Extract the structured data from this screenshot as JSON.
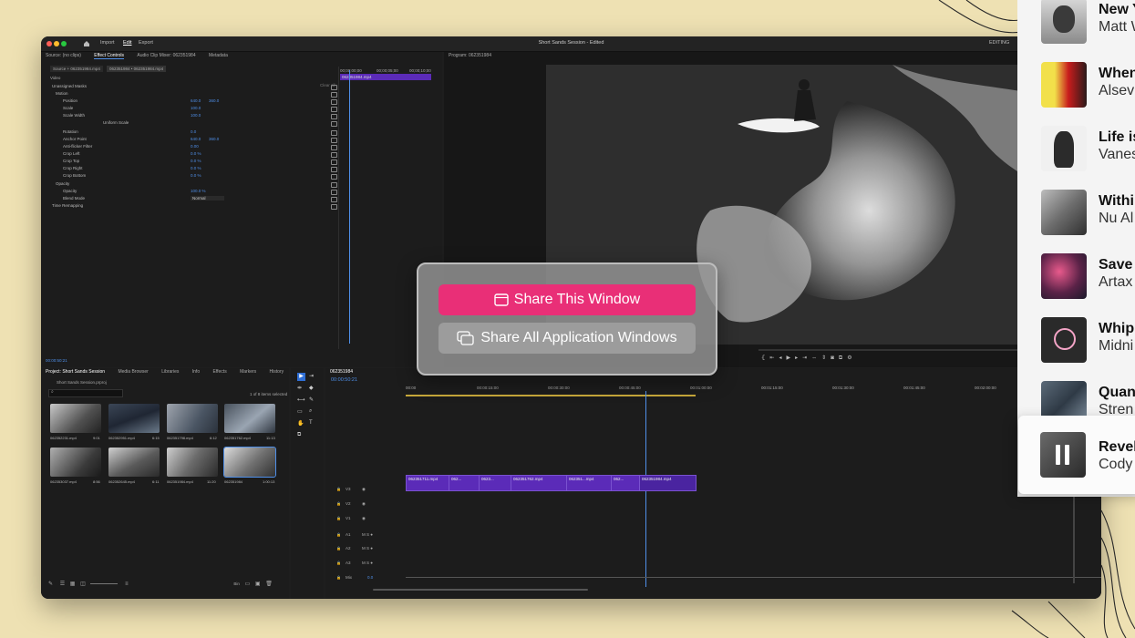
{
  "window": {
    "nav": [
      "Import",
      "Edit",
      "Export"
    ],
    "title": "Short Sands Session - Edited",
    "workspace": "EDITING"
  },
  "source_panel": {
    "tabs": [
      "Source: (no clips)",
      "Effect Controls",
      "Audio Clip Mixer: 062351984",
      "Metadata"
    ],
    "source_label": "Source + 062351984.mp4",
    "sequence_label": "062351984 • 062351984.mp4",
    "timeline_ticks": [
      "00;00;00;00",
      "00;00;05;00",
      "00;00;10;00"
    ],
    "clip_label": "062351984.mp4",
    "video_label": "Video",
    "clear_label": "Clear all",
    "timecode": "00:00:50:21",
    "rows": [
      {
        "label": "Unassigned Masks",
        "value": "",
        "value2": ""
      },
      {
        "label": "Motion",
        "value": "",
        "value2": ""
      },
      {
        "label": "Position",
        "value": "640.0",
        "value2": "360.0"
      },
      {
        "label": "Scale",
        "value": "100.0",
        "value2": ""
      },
      {
        "label": "Scale Width",
        "value": "100.0",
        "value2": ""
      },
      {
        "label": "Uniform Scale",
        "value": "",
        "value2": ""
      },
      {
        "label": "Rotation",
        "value": "0.0",
        "value2": ""
      },
      {
        "label": "Anchor Point",
        "value": "640.0",
        "value2": "360.0"
      },
      {
        "label": "Anti-flicker Filter",
        "value": "0.00",
        "value2": ""
      },
      {
        "label": "Crop Left",
        "value": "0.0 %",
        "value2": ""
      },
      {
        "label": "Crop Top",
        "value": "0.0 %",
        "value2": ""
      },
      {
        "label": "Crop Right",
        "value": "0.0 %",
        "value2": ""
      },
      {
        "label": "Crop Bottom",
        "value": "0.0 %",
        "value2": ""
      },
      {
        "label": "Opacity",
        "value": "",
        "value2": ""
      },
      {
        "label": "Opacity",
        "value": "100.0 %",
        "value2": ""
      },
      {
        "label": "Blend Mode",
        "value": "Normal",
        "value2": ""
      },
      {
        "label": "Time Remapping",
        "value": "",
        "value2": ""
      }
    ]
  },
  "program_panel": {
    "tab": "Program: 062351984"
  },
  "project_panel": {
    "tabs": [
      "Project: Short Sands Session",
      "Media Browser",
      "Libraries",
      "Info",
      "Effects",
      "Markers",
      "History"
    ],
    "file": "Short Sands Session.prproj",
    "selection_info": "1 of 8 items selected",
    "clips": [
      {
        "name": "062352231.mp4",
        "duration": "9:01"
      },
      {
        "name": "062352951.mp4",
        "duration": "6:15"
      },
      {
        "name": "062351798.mp4",
        "duration": "6:12"
      },
      {
        "name": "062351762.mp4",
        "duration": "11:13"
      },
      {
        "name": "062353037.mp4",
        "duration": "8:56"
      },
      {
        "name": "062352645.mp4",
        "duration": "6:11"
      },
      {
        "name": "062351984.mp4",
        "duration": "11:20"
      },
      {
        "name": "062351984",
        "duration": "1:00:13"
      }
    ],
    "bin_label": "Bin"
  },
  "timeline": {
    "tab": "062351984",
    "timecode": "00:00:50:21",
    "ruler": [
      "00:00",
      "00:00:15:00",
      "00:00:30:00",
      "00:00:45:00",
      "00:01:00:00",
      "00:01:15:00",
      "00:01:30:00",
      "00:01:45:00",
      "00:02:00:00"
    ],
    "tracks": [
      "V3",
      "V2",
      "V1",
      "A1",
      "A2",
      "A3",
      "Mix"
    ],
    "mix_value": "0.0",
    "clip_labels": [
      "062351711.mp4",
      "062...",
      "0623...",
      "062351762.mp4",
      "062351...mp4",
      "062...",
      "062351984.mp4"
    ]
  },
  "share_dialog": {
    "primary": "Share This Window",
    "secondary": "Share All Application Windows"
  },
  "music_list": [
    {
      "title": "New Y",
      "artist": "Matt W"
    },
    {
      "title": "When",
      "artist": "Alsev"
    },
    {
      "title": "Life is",
      "artist": "Vanes"
    },
    {
      "title": "Withi",
      "artist": "Nu Al"
    },
    {
      "title": "Save",
      "artist": "Artax"
    },
    {
      "title": "Whip",
      "artist": "Midni"
    },
    {
      "title": "Quan",
      "artist": "Stren"
    }
  ],
  "now_playing": {
    "title": "Revel",
    "artist": "Cody"
  },
  "colors": {
    "accent": "#e92f77",
    "clip": "#5b2bb8",
    "playhead": "#4f8fe8",
    "background": "#eee1b3"
  }
}
